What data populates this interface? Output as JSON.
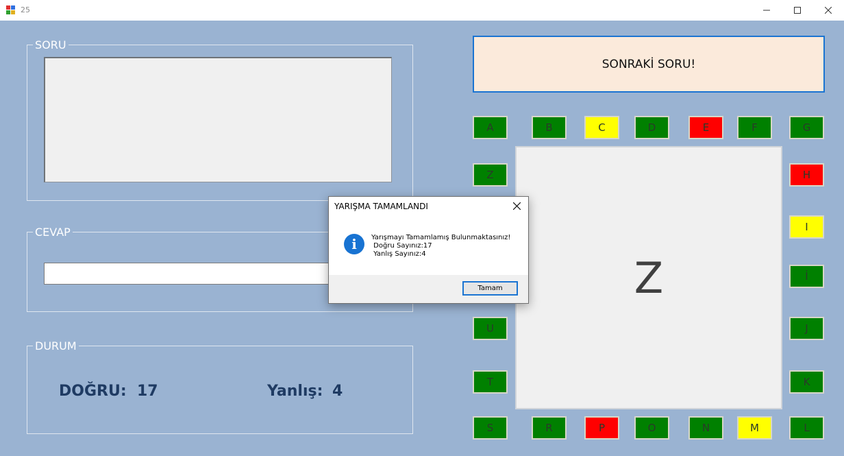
{
  "window": {
    "title": "25"
  },
  "groups": {
    "question": "SORU",
    "answer": "CEVAP",
    "status": "DURUM"
  },
  "stats": {
    "correct_label": "DOĞRU:",
    "correct_value": "17",
    "wrong_label": "Yanlış:",
    "wrong_value": "4"
  },
  "next_button": "SONRAKİ SORU!",
  "board": {
    "center_letter": "Z",
    "letters": [
      {
        "letter": "A",
        "color": "#008000"
      },
      {
        "letter": "B",
        "color": "#008000"
      },
      {
        "letter": "C",
        "color": "#ffff00"
      },
      {
        "letter": "D",
        "color": "#008000"
      },
      {
        "letter": "E",
        "color": "#ff0000"
      },
      {
        "letter": "F",
        "color": "#008000"
      },
      {
        "letter": "G",
        "color": "#008000"
      },
      {
        "letter": "H",
        "color": "#ff0000"
      },
      {
        "letter": "I",
        "color": "#ffff00"
      },
      {
        "letter": "İ",
        "color": "#008000"
      },
      {
        "letter": "J",
        "color": "#008000"
      },
      {
        "letter": "K",
        "color": "#008000"
      },
      {
        "letter": "L",
        "color": "#008000"
      },
      {
        "letter": "M",
        "color": "#ffff00"
      },
      {
        "letter": "N",
        "color": "#008000"
      },
      {
        "letter": "O",
        "color": "#008000"
      },
      {
        "letter": "P",
        "color": "#ff0000"
      },
      {
        "letter": "R",
        "color": "#008000"
      },
      {
        "letter": "S",
        "color": "#008000"
      },
      {
        "letter": "T",
        "color": "#008000"
      },
      {
        "letter": "U",
        "color": "#008000"
      },
      {
        "letter": "Z",
        "color": "#008000"
      }
    ]
  },
  "dialog": {
    "title": "YARIŞMA TAMAMLANDI",
    "message": "Yarışmayı Tamamlamış Bulunmaktasınız!\n Doğru Sayınız:17\n Yanlış Sayınız:4",
    "ok_label": "Tamam",
    "icon": "info-icon"
  }
}
